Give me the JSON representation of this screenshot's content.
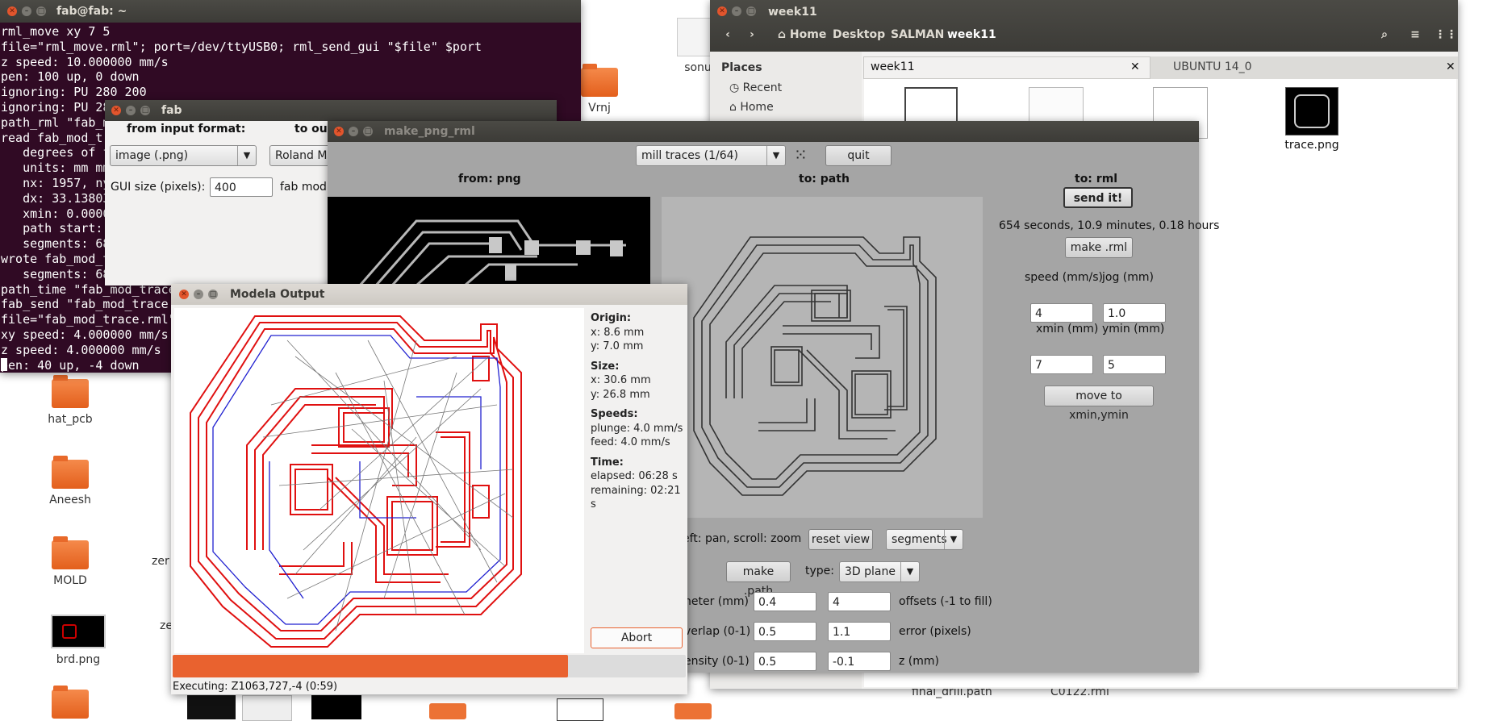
{
  "desktop": {
    "icons": [
      {
        "label": "hat_pcb"
      },
      {
        "label": "Aneesh"
      },
      {
        "label": "MOLD"
      },
      {
        "label": "brd.png"
      },
      {
        "label": "Vrnj"
      },
      {
        "label": "sonu"
      },
      {
        "label": "zer"
      },
      {
        "label": "ze"
      }
    ],
    "bottom_labels": [
      "final_drill.path",
      "C0122.rml"
    ]
  },
  "terminal": {
    "title": "fab@fab: ~",
    "lines": [
      "rml_move xy 7 5",
      "file=\"rml_move.rml\"; port=/dev/ttyUSB0; rml_send_gui \"$file\" $port",
      "z speed: 10.000000 mm/s",
      "pen: 100 up, 0 down",
      "ignoring: PU 280 200",
      "ignoring: PU 28",
      "path_rml \"fab_m",
      "read fab_mod_tr",
      "   degrees of f",
      "   units: mm mm",
      "   nx: 1957, ny",
      "   dx: 33.13803",
      "   xmin: 0.000000, ymin: 0.000000, zmin: -0.1",
      "   path start:",
      "   segments: 68, points: 1934",
      "wrote fab_mod_trace.rml",
      "   segments: 68, points: 1866",
      "path_time \"fab_mod_trace.path\" 4 1.0 > \"fab m",
      "fab_send \"fab_mod_trace.",
      "file=\"fab_mod_trace.rml\"",
      "xy speed: 4.000000 mm/s",
      "z speed: 4.000000 mm/s",
      "pen: 40 up, -4 down"
    ]
  },
  "nautilus": {
    "title": "week11",
    "breadcrumb": [
      "Home",
      "Desktop",
      "SALMAN",
      "week11"
    ],
    "places_header": "Places",
    "places": [
      "Recent",
      "Home"
    ],
    "tabs": [
      "week11",
      "UBUNTU 14_0"
    ],
    "files": [
      {
        "label": "trace.png"
      }
    ]
  },
  "fab": {
    "title": "fab",
    "from_label": "from input format:",
    "to_label": "to out",
    "input_format": "image (.png)",
    "output_format": "Roland MD",
    "gui_size_label": "GUI size (pixels):",
    "gui_size_value": "400",
    "fab_mod_label": "fab mod"
  },
  "make_png_rml": {
    "title": "make_png_rml",
    "process": "mill traces (1/64)",
    "quit_label": "quit",
    "from_header": "from: png",
    "to_path_header": "to: path",
    "to_rml_header": "to: rml",
    "send_label": "send it!",
    "time_estimate": "654 seconds, 10.9 minutes, 0.18 hours",
    "make_rml_label": "make .rml",
    "speed_label": "speed (mm/s)",
    "jog_label": "jog (mm)",
    "speed_value": "4",
    "jog_value": "1.0",
    "xmin_label": "xmin (mm)",
    "ymin_label": "ymin (mm)",
    "xmin_value": "7",
    "ymin_value": "5",
    "move_label": "move to xmin,ymin",
    "pan_hint": "eft: pan, scroll: zoom",
    "reset_view_label": "reset view",
    "segments_value": "segments",
    "make_path_label": "make .path",
    "type_label": "type:",
    "type_value": "3D plane",
    "diameter_label": "neter (mm)",
    "diameter_value": "0.4",
    "offsets_value": "4",
    "offsets_label": "offsets (-1 to fill)",
    "overlap_label": "verlap (0-1)",
    "overlap_value": "0.5",
    "error_value": "1.1",
    "error_label": "error (pixels)",
    "intensity_label": "ensity (0-1)",
    "intensity_value": "0.5",
    "z_value": "-0.1",
    "z_label": "z (mm)"
  },
  "modela": {
    "title": "Modela Output",
    "origin_header": "Origin:",
    "origin_x": "x: 8.6 mm",
    "origin_y": "y: 7.0 mm",
    "size_header": "Size:",
    "size_x": "x: 30.6 mm",
    "size_y": "y: 26.8 mm",
    "speeds_header": "Speeds:",
    "plunge": "plunge: 4.0 mm/s",
    "feed": "feed: 4.0 mm/s",
    "time_header": "Time:",
    "elapsed": "elapsed: 06:28 s",
    "remaining": "remaining: 02:21 s",
    "abort_label": "Abort",
    "progress_fraction": 0.77,
    "status": "Executing: Z1063,727,-4 (0:59)",
    "progress_color": "#e9622f"
  }
}
